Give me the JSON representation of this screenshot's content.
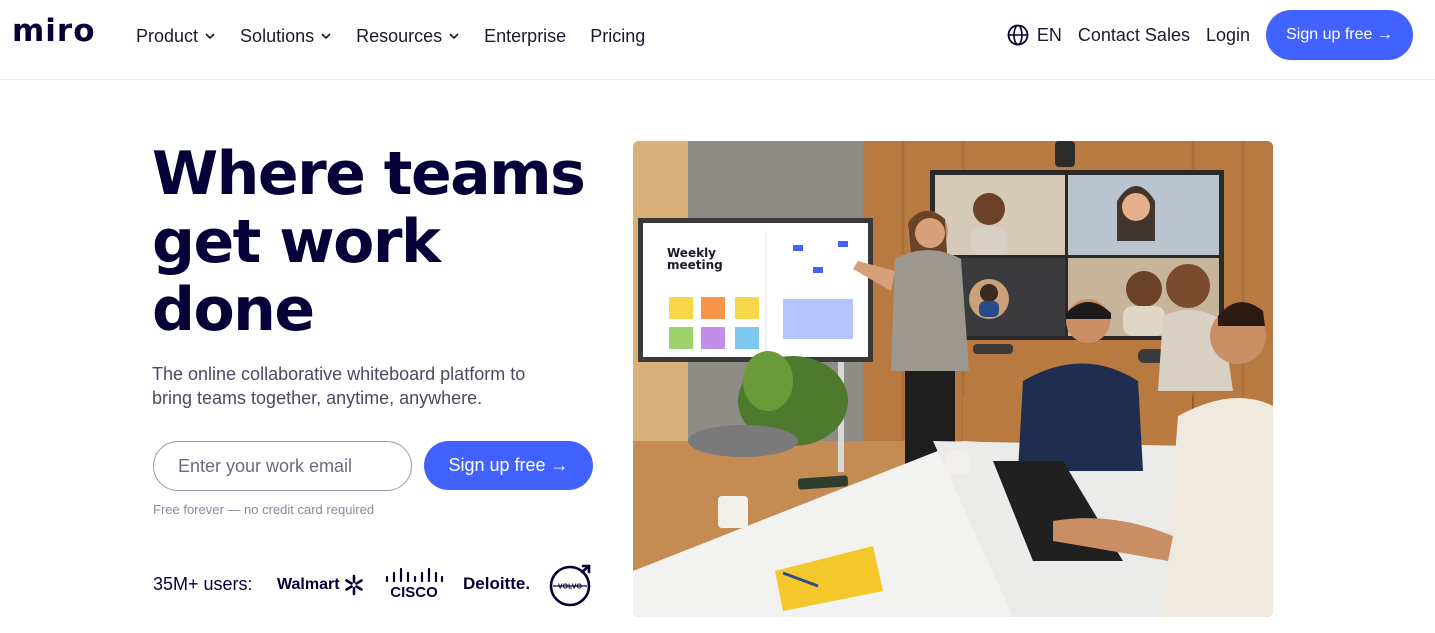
{
  "nav": {
    "logo": "miro",
    "menu": [
      {
        "label": "Product",
        "dropdown": true
      },
      {
        "label": "Solutions",
        "dropdown": true
      },
      {
        "label": "Resources",
        "dropdown": true
      },
      {
        "label": "Enterprise",
        "dropdown": false
      },
      {
        "label": "Pricing",
        "dropdown": false
      }
    ],
    "language": "EN",
    "contact_sales": "Contact Sales",
    "login": "Login",
    "signup": "Sign up free →"
  },
  "hero": {
    "title_lines": [
      "Where teams",
      "get work",
      "done"
    ],
    "subtitle_lines": [
      "The online collaborative whiteboard platform to",
      "bring teams together, anytime, anywhere."
    ],
    "email_placeholder": "Enter your work email",
    "email_value": "",
    "signup": "Sign up free →",
    "note": "Free forever — no credit card required",
    "users": "35M+ users:",
    "customer_logos": {
      "walmart": "Walmart",
      "cisco": "CISCO",
      "deloitte": "Deloitte.",
      "volvo": "VOLVO"
    }
  },
  "board": {
    "title_lines": [
      "Weekly",
      "meeting"
    ]
  },
  "colors": {
    "primary": "#4262ff",
    "text_dark": "#050038",
    "text_muted": "#4a4a63"
  }
}
